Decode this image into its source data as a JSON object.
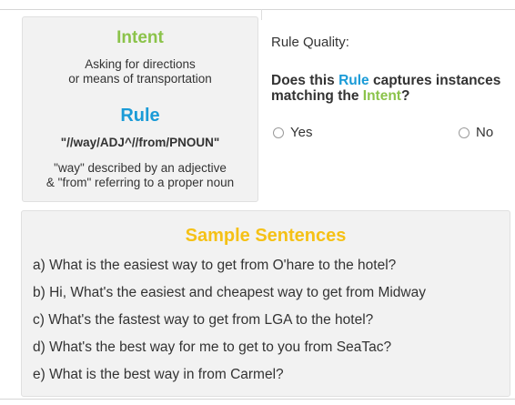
{
  "intent": {
    "title": "Intent",
    "description_line1": "Asking for directions",
    "description_line2": "or means of transportation"
  },
  "rule": {
    "title": "Rule",
    "pattern": "\"//way/ADJ^//from/PNOUN\"",
    "description_line1": "\"way\" described by an adjective",
    "description_line2": "& \"from\" referring to a proper noun"
  },
  "quality": {
    "label": "Rule Quality:",
    "question_part1": "Does this ",
    "question_rule": "Rule",
    "question_part2": " captures instances matching the ",
    "question_intent": "Intent",
    "question_end": "?",
    "options": [
      {
        "label": "Yes",
        "selected": false
      },
      {
        "label": "No",
        "selected": false
      }
    ]
  },
  "samples": {
    "title": "Sample Sentences",
    "items": [
      "a) What is the easiest way to get from O'hare to the hotel?",
      "b) Hi, What's the easiest and cheapest way to get from Midway",
      "c) What's the fastest way to get from LGA to the hotel?",
      "d) What's the best way for me to get to you from SeaTac?",
      "e) What is the best way in from Carmel?"
    ]
  },
  "colors": {
    "intent_green": "#8bc34a",
    "rule_blue": "#1a9bd7",
    "samples_yellow": "#f5c116",
    "card_bg": "#f2f2f2"
  }
}
